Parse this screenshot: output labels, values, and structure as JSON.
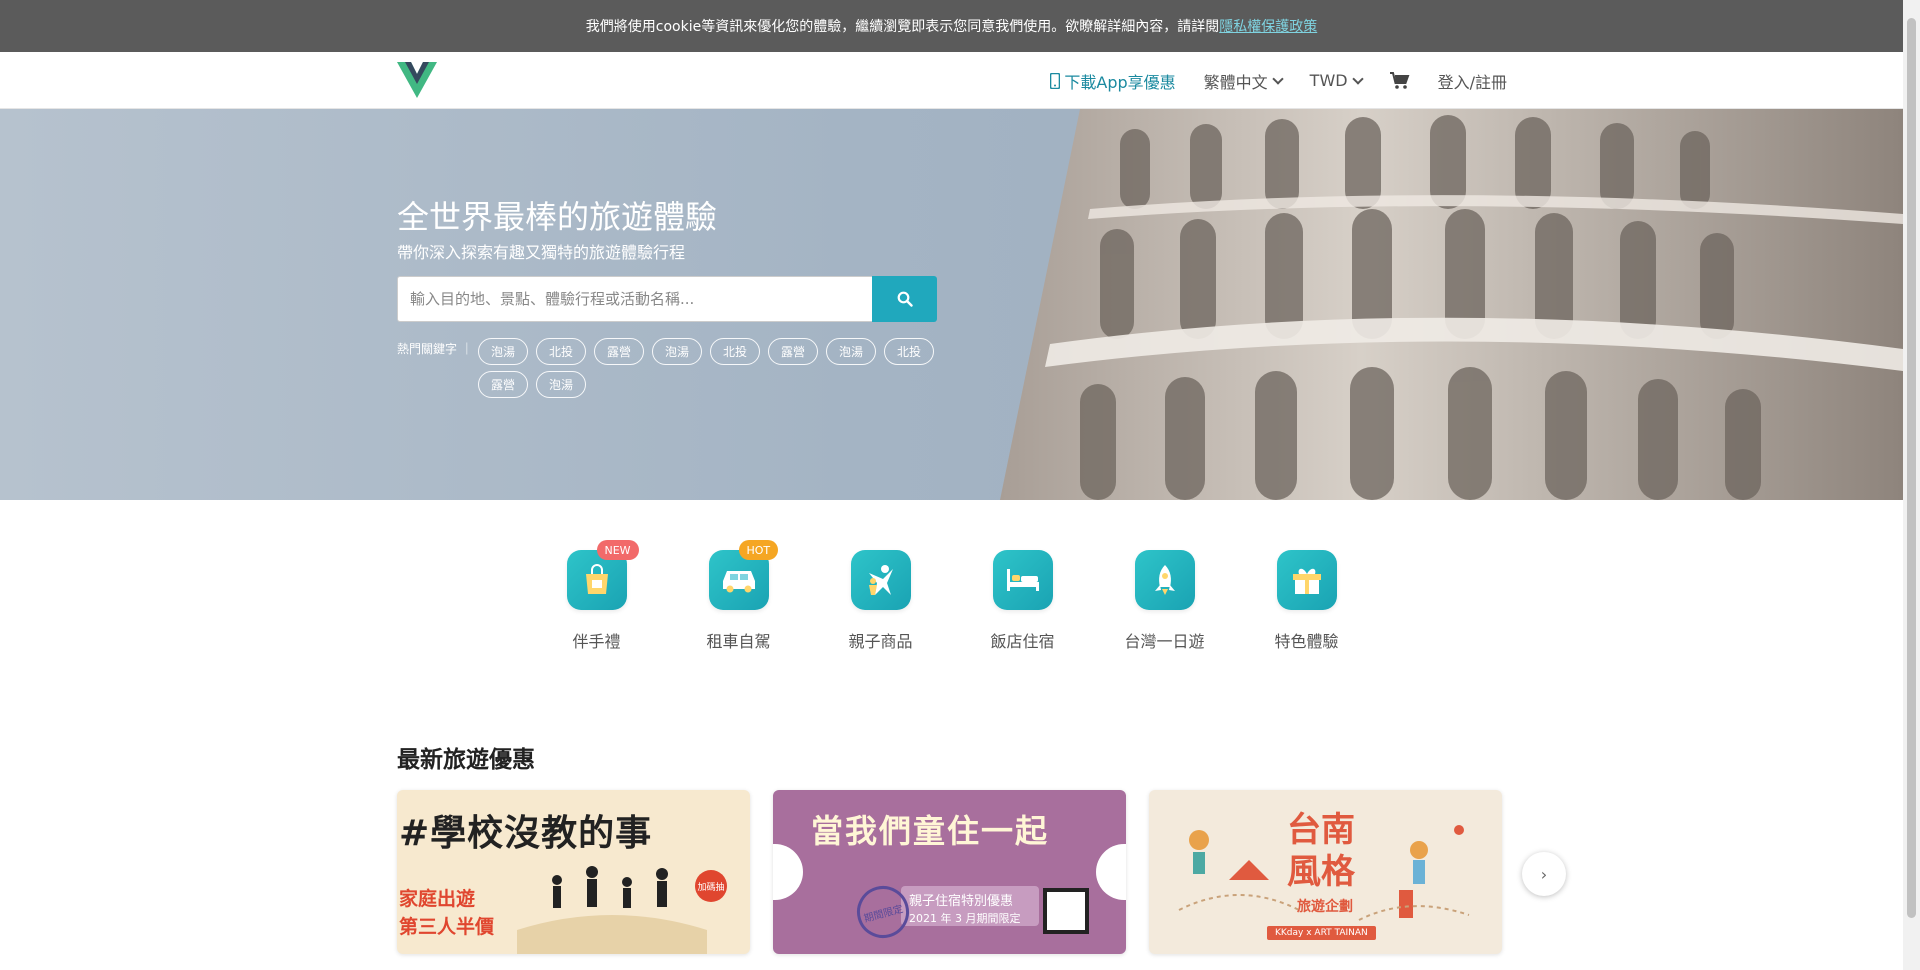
{
  "cookie": {
    "text": "我們將使用cookie等資訊來優化您的體驗，繼續瀏覽即表示您同意我們使用。欲瞭解詳細內容，請詳閱",
    "link": "隱私權保護政策"
  },
  "header": {
    "app_link": "下載App享優惠",
    "language": "繁體中文",
    "currency": "TWD",
    "login": "登入/註冊"
  },
  "hero": {
    "title": "全世界最棒的旅遊體驗",
    "subtitle": "帶你深入探索有趣又獨特的旅遊體驗行程",
    "search_placeholder": "輸入目的地、景點、體驗行程或活動名稱...",
    "hot_keywords_label": "熱門關鍵字",
    "tags": [
      "泡湯",
      "北投",
      "露營",
      "泡湯",
      "北投",
      "露營",
      "泡湯",
      "北投",
      "露營",
      "泡湯"
    ]
  },
  "categories": [
    {
      "label": "伴手禮",
      "badge": "NEW",
      "icon": "gift-bag-icon"
    },
    {
      "label": "租車自駕",
      "badge": "HOT",
      "icon": "car-icon"
    },
    {
      "label": "親子商品",
      "badge": "",
      "icon": "family-icon"
    },
    {
      "label": "飯店住宿",
      "badge": "",
      "icon": "bed-icon"
    },
    {
      "label": "台灣一日遊",
      "badge": "",
      "icon": "rocket-icon"
    },
    {
      "label": "特色體驗",
      "badge": "",
      "icon": "gift-box-icon"
    }
  ],
  "deals": {
    "title": "最新旅遊優惠",
    "cards": [
      {
        "headline": "#學校沒教的事",
        "line1": "家庭出遊",
        "line2": "第三人半價",
        "tag": "加碼抽"
      },
      {
        "headline": "當我們童住一起",
        "line1": "親子住宿特別優惠",
        "line2": "2021 年 3 月期間限定",
        "stamp": "期間限定"
      },
      {
        "headline1": "台南",
        "headline2": "風格",
        "line1": "旅遊企劃",
        "line2": "KKday x ART TAINAN"
      }
    ],
    "next": "›"
  },
  "colors": {
    "accent": "#20a8bd",
    "cookie_bg": "#5b5b5b",
    "badge_new": "#f26a6a",
    "badge_hot": "#f5a623"
  }
}
